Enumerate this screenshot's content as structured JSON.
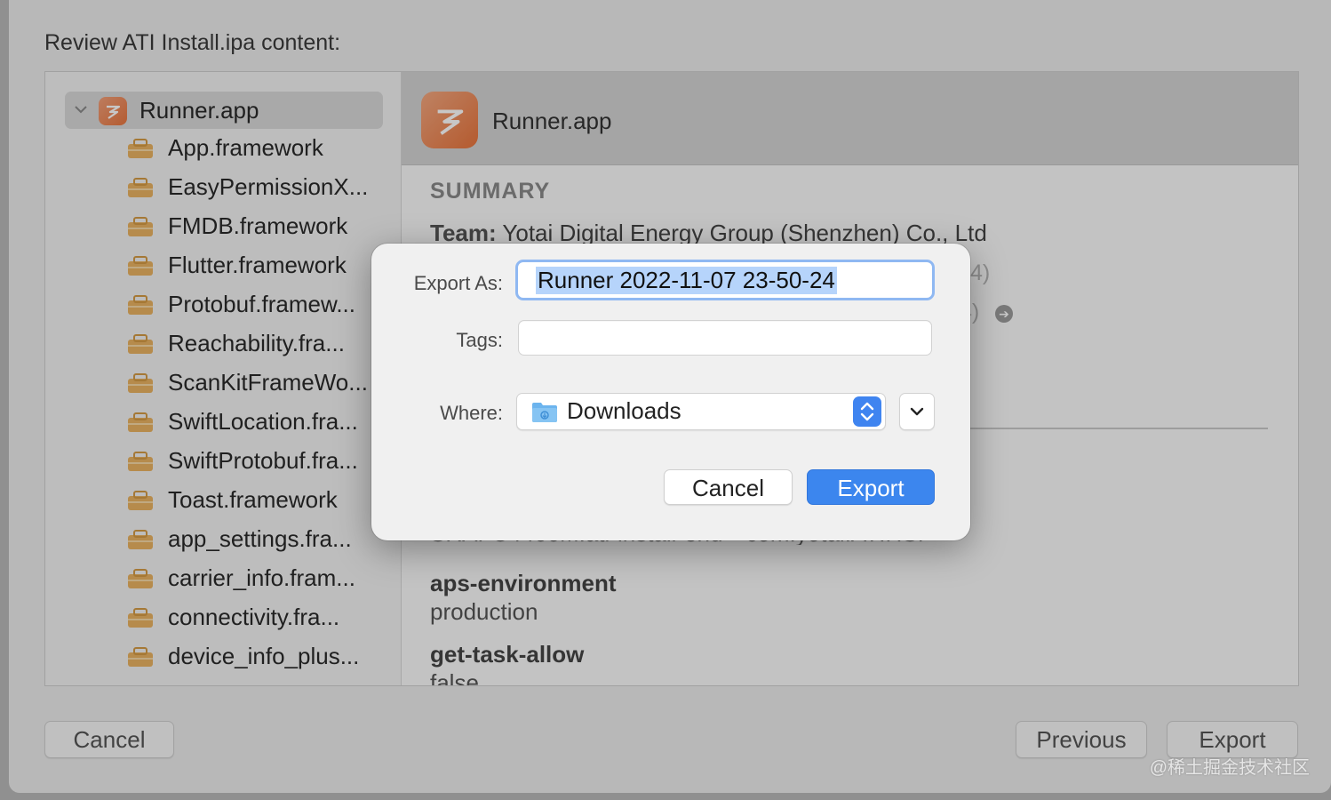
{
  "sheet": {
    "title": "Review ATI Install.ipa content:",
    "cancel_label": "Cancel",
    "previous_label": "Previous",
    "export_label": "Export"
  },
  "tree": {
    "root_label": "Runner.app",
    "items": [
      "App.framework",
      "EasyPermissionX...",
      "FMDB.framework",
      "Flutter.framework",
      "Protobuf.framew...",
      "Reachability.fra...",
      "ScanKitFrameWo...",
      "SwiftLocation.fra...",
      "SwiftProtobuf.fra...",
      "Toast.framework",
      "app_settings.fra...",
      "carrier_info.fram...",
      "connectivity.fra...",
      "device_info_plus..."
    ]
  },
  "detail": {
    "title": "Runner.app",
    "summary_heading": "SUMMARY",
    "team_key": "Team:",
    "team_value": "Yotai Digital Energy Group (Shenzhen) Co., Ltd",
    "ghost_line1": "4)",
    "ghost_line2": "4)",
    "cut_line": "SRAFC4466M.ati-install-end---com.yotai.ATIHSI",
    "entitlements": [
      {
        "key": "aps-environment",
        "value": "production"
      },
      {
        "key": "get-task-allow",
        "value": "false"
      }
    ]
  },
  "dialog": {
    "export_as_label": "Export As:",
    "export_as_value": "Runner 2022-11-07 23-50-24",
    "tags_label": "Tags:",
    "tags_value": "",
    "where_label": "Where:",
    "where_value": "Downloads",
    "cancel_label": "Cancel",
    "export_label": "Export"
  },
  "watermark": "@稀土掘金技术社区",
  "colors": {
    "accent": "#3c86ee",
    "selection": "#b6d4fb",
    "app_icon": "#e8763f",
    "framework_icon": "#e9b262"
  }
}
